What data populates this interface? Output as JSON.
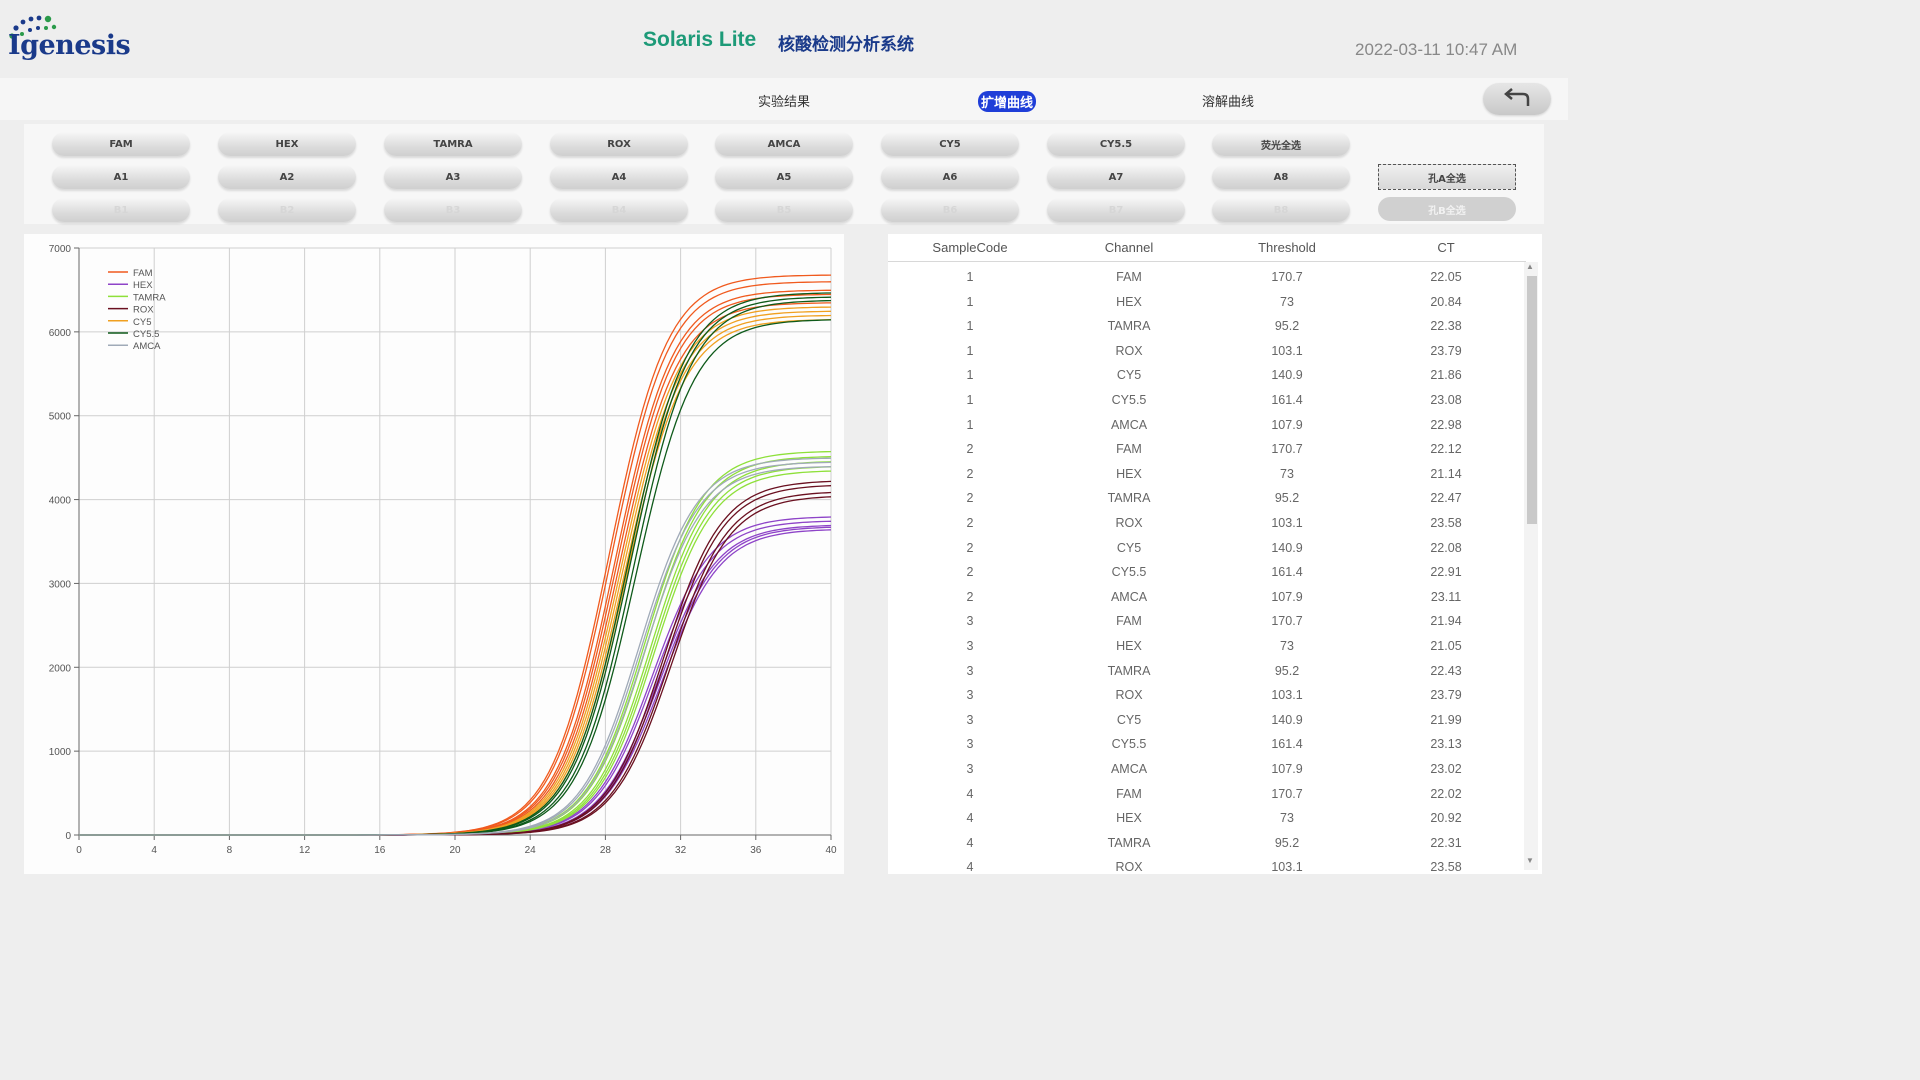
{
  "header": {
    "logo_text": "Igenesis",
    "app_title": "Solaris Lite",
    "app_subtitle": "核酸检测分析系统",
    "datetime": "2022-03-11 10:47 AM"
  },
  "tabs": [
    {
      "label": "实验结果",
      "active": false
    },
    {
      "label": "扩增曲线",
      "active": true
    },
    {
      "label": "溶解曲线",
      "active": false
    }
  ],
  "channel_buttons": [
    "FAM",
    "HEX",
    "TAMRA",
    "ROX",
    "AMCA",
    "CY5",
    "CY5.5",
    "荧光全选"
  ],
  "well_row_a": [
    "A1",
    "A2",
    "A3",
    "A4",
    "A5",
    "A6",
    "A7",
    "A8"
  ],
  "well_row_b": [
    "B1",
    "B2",
    "B3",
    "B4",
    "B5",
    "B6",
    "B7",
    "B8"
  ],
  "select_all_a": "孔A全选",
  "select_all_b": "孔B全选",
  "colors": {
    "FAM": "#f05a1e",
    "HEX": "#8e44c8",
    "TAMRA": "#8ee03a",
    "ROX": "#6a1020",
    "CY5": "#f0a020",
    "CY5.5": "#0e5a1a",
    "AMCA": "#a0aab8",
    "accent": "#1f3ed8",
    "title": "#1d9a78"
  },
  "table": {
    "columns": [
      "SampleCode",
      "Channel",
      "Threshold",
      "CT"
    ],
    "rows": [
      [
        "1",
        "FAM",
        "170.7",
        "22.05"
      ],
      [
        "1",
        "HEX",
        "73",
        "20.84"
      ],
      [
        "1",
        "TAMRA",
        "95.2",
        "22.38"
      ],
      [
        "1",
        "ROX",
        "103.1",
        "23.79"
      ],
      [
        "1",
        "CY5",
        "140.9",
        "21.86"
      ],
      [
        "1",
        "CY5.5",
        "161.4",
        "23.08"
      ],
      [
        "1",
        "AMCA",
        "107.9",
        "22.98"
      ],
      [
        "2",
        "FAM",
        "170.7",
        "22.12"
      ],
      [
        "2",
        "HEX",
        "73",
        "21.14"
      ],
      [
        "2",
        "TAMRA",
        "95.2",
        "22.47"
      ],
      [
        "2",
        "ROX",
        "103.1",
        "23.58"
      ],
      [
        "2",
        "CY5",
        "140.9",
        "22.08"
      ],
      [
        "2",
        "CY5.5",
        "161.4",
        "22.91"
      ],
      [
        "2",
        "AMCA",
        "107.9",
        "23.11"
      ],
      [
        "3",
        "FAM",
        "170.7",
        "21.94"
      ],
      [
        "3",
        "HEX",
        "73",
        "21.05"
      ],
      [
        "3",
        "TAMRA",
        "95.2",
        "22.43"
      ],
      [
        "3",
        "ROX",
        "103.1",
        "23.79"
      ],
      [
        "3",
        "CY5",
        "140.9",
        "21.99"
      ],
      [
        "3",
        "CY5.5",
        "161.4",
        "23.13"
      ],
      [
        "3",
        "AMCA",
        "107.9",
        "23.02"
      ],
      [
        "4",
        "FAM",
        "170.7",
        "22.02"
      ],
      [
        "4",
        "HEX",
        "73",
        "20.92"
      ],
      [
        "4",
        "TAMRA",
        "95.2",
        "22.31"
      ],
      [
        "4",
        "ROX",
        "103.1",
        "23.58"
      ]
    ]
  },
  "chart_data": {
    "type": "line",
    "x_ticks": [
      "0",
      "4",
      "8",
      "12",
      "16",
      "20",
      "24",
      "28",
      "32",
      "36",
      "40"
    ],
    "y_ticks": [
      "0",
      "1000",
      "2000",
      "3000",
      "4000",
      "5000",
      "6000",
      "7000"
    ],
    "xlim": [
      0,
      40
    ],
    "ylim": [
      0,
      7000
    ],
    "grid": true,
    "legend_position": "top-left",
    "series": [
      {
        "name": "FAM",
        "color": "#f05a1e",
        "plateaus": [
          6680,
          6600,
          6500,
          6450,
          6350
        ],
        "midpoints": [
          28.2,
          28.3,
          28.5,
          28.6,
          28.7
        ]
      },
      {
        "name": "HEX",
        "color": "#8e44c8",
        "plateaus": [
          3800,
          3750,
          3700,
          3680,
          3650
        ],
        "midpoints": [
          30.5,
          30.6,
          30.8,
          30.9,
          31.0
        ]
      },
      {
        "name": "TAMRA",
        "color": "#8ee03a",
        "plateaus": [
          4580,
          4520,
          4460,
          4400,
          4350
        ],
        "midpoints": [
          30.1,
          30.2,
          30.4,
          30.5,
          30.6
        ]
      },
      {
        "name": "ROX",
        "color": "#6a1020",
        "plateaus": [
          4230,
          4180,
          4100,
          4050
        ],
        "midpoints": [
          31.1,
          31.2,
          31.4,
          31.5
        ]
      },
      {
        "name": "CY5",
        "color": "#f0a020",
        "plateaus": [
          6300,
          6250,
          6200,
          6150
        ],
        "midpoints": [
          28.8,
          28.9,
          29.0,
          29.1
        ]
      },
      {
        "name": "CY5.5",
        "color": "#0e5a1a",
        "plateaus": [
          6470,
          6420,
          6380,
          6150
        ],
        "midpoints": [
          29.2,
          29.3,
          29.5,
          29.6
        ]
      },
      {
        "name": "AMCA",
        "color": "#a0aab8",
        "plateaus": [
          4500,
          4450,
          4400
        ],
        "midpoints": [
          29.8,
          29.9,
          30.1
        ]
      }
    ]
  }
}
